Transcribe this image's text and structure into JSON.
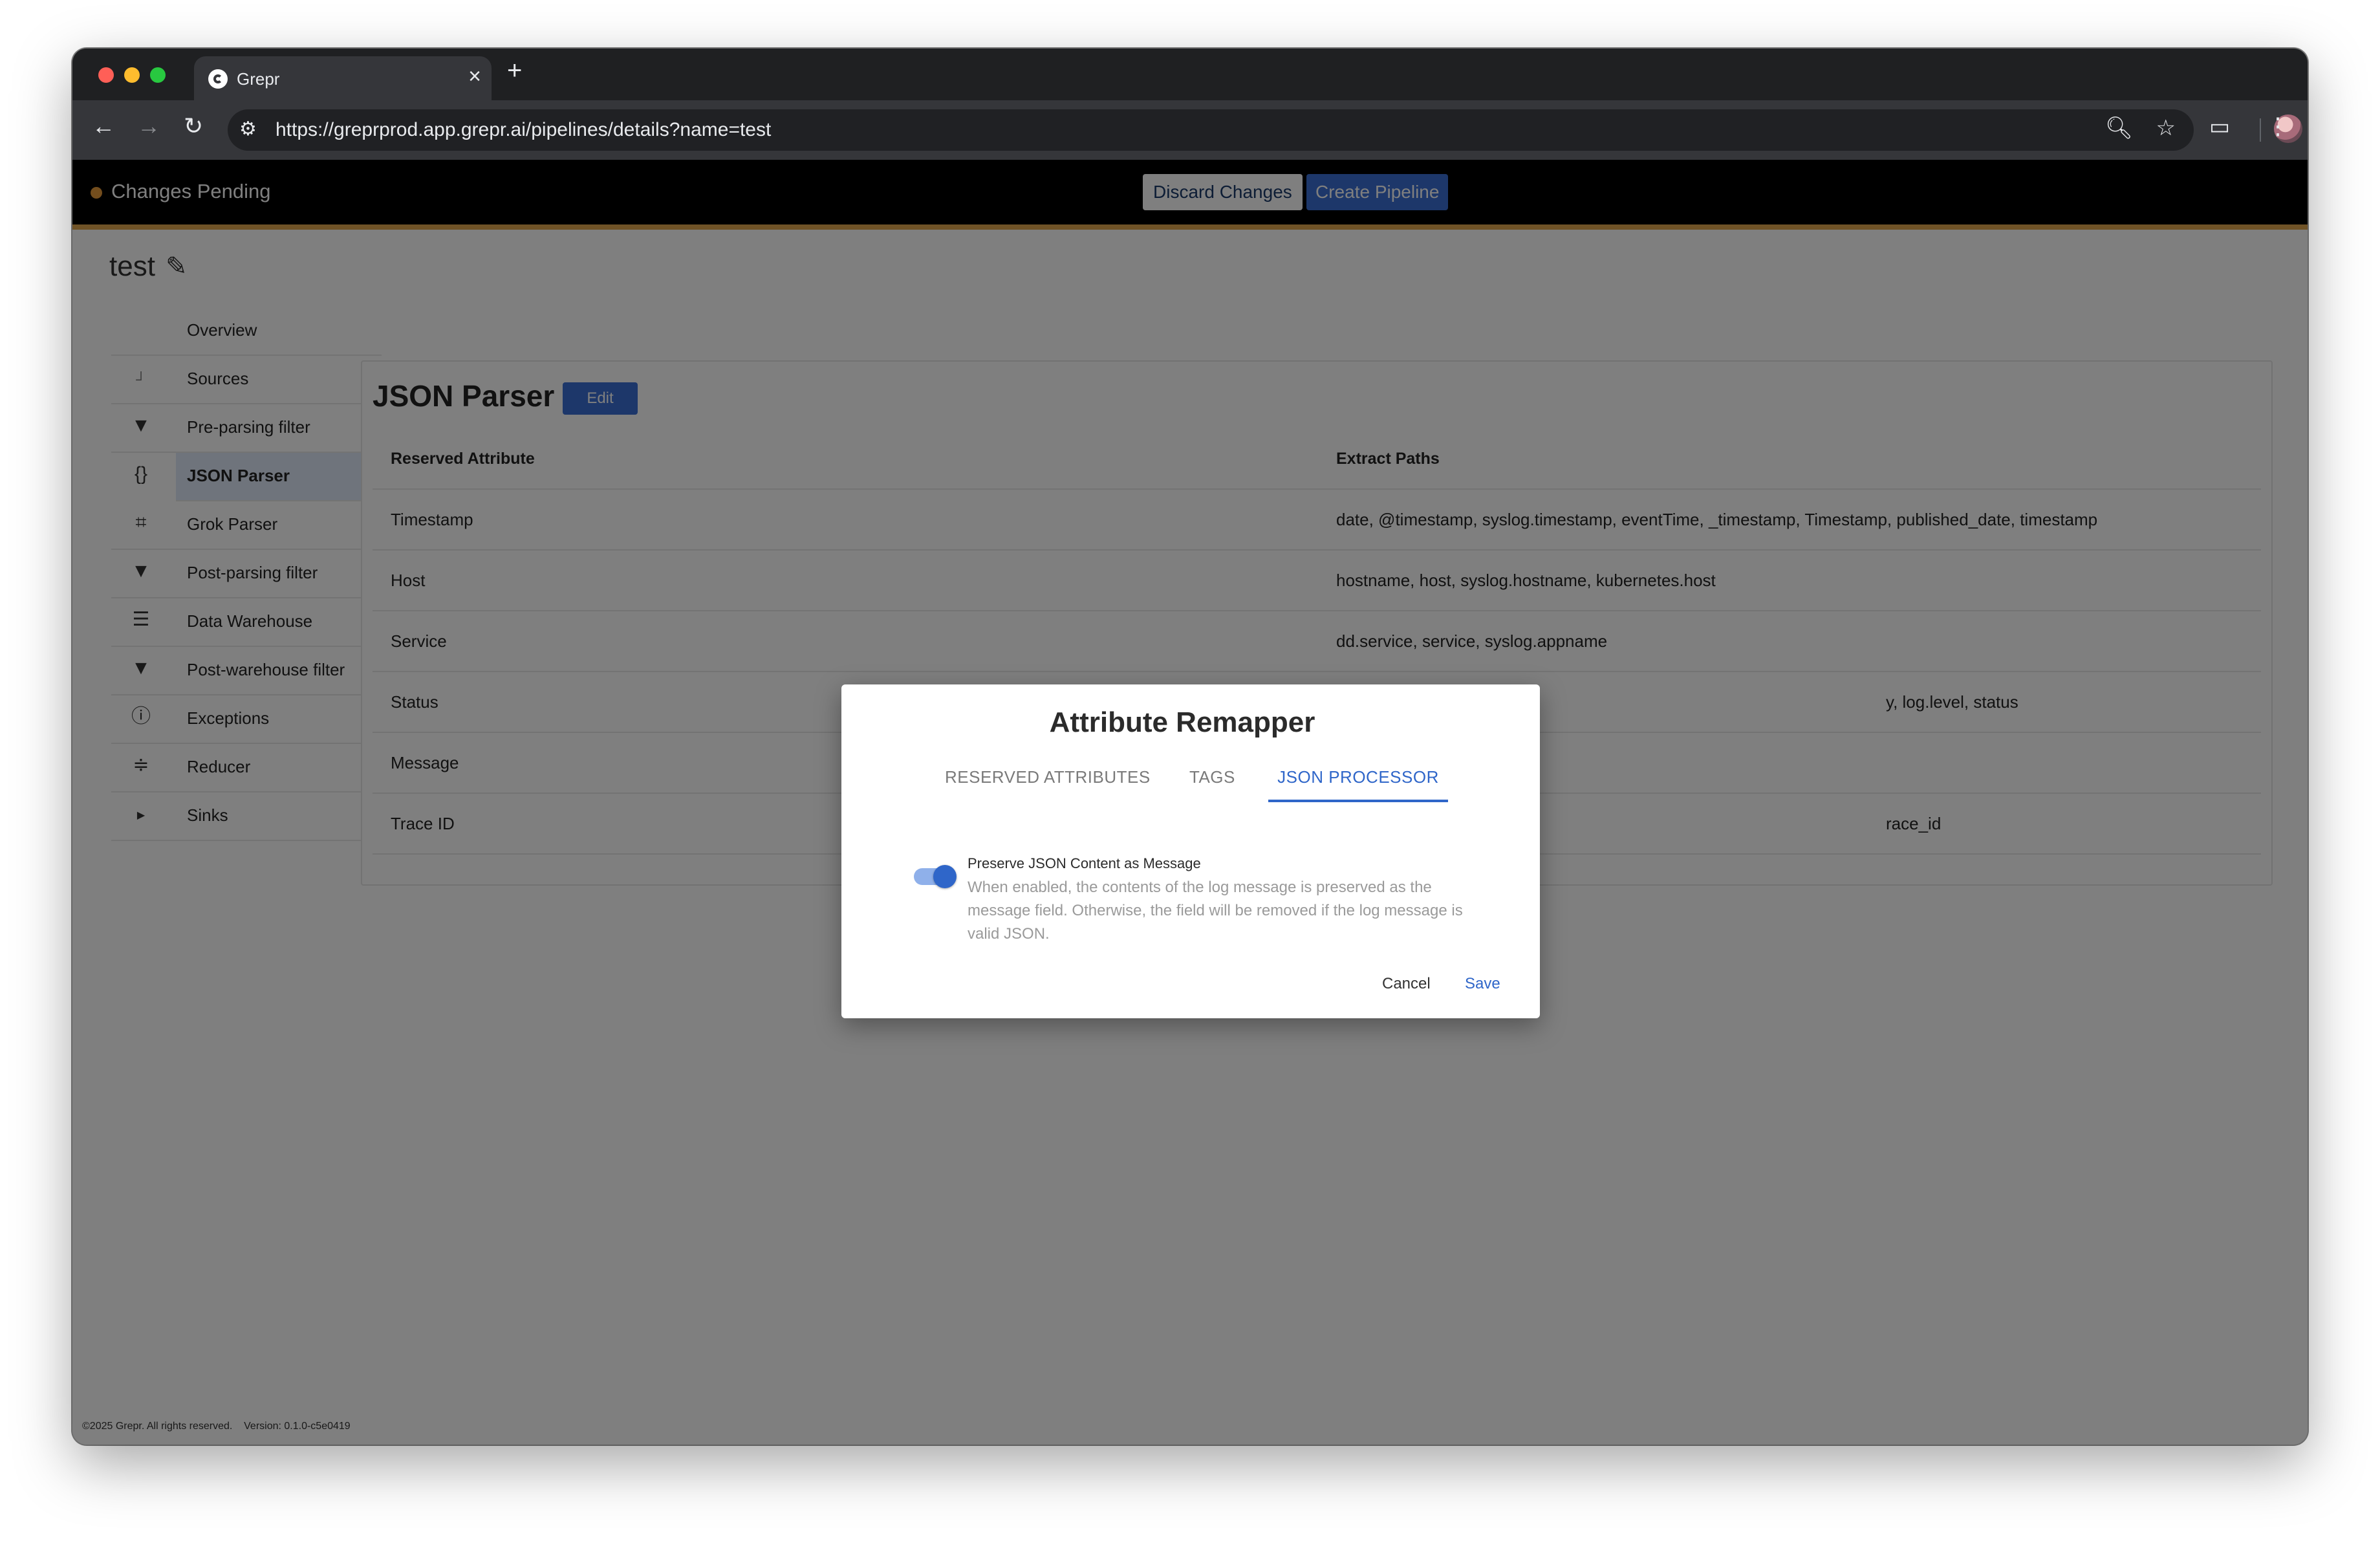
{
  "browser": {
    "tab_title": "Grepr",
    "url": "https://greprprod.app.grepr.ai/pipelines/details?name=test"
  },
  "banner": {
    "status_text": "Changes Pending",
    "discard_label": "Discard Changes",
    "create_label": "Create Pipeline"
  },
  "pipeline": {
    "name": "test"
  },
  "sidebar": {
    "items": [
      {
        "label": "Overview",
        "icon": "none"
      },
      {
        "label": "Sources",
        "icon": "branch-connector"
      },
      {
        "label": "Pre-parsing filter",
        "icon": "filter-icon"
      },
      {
        "label": "JSON Parser",
        "icon": "braces-icon"
      },
      {
        "label": "Grok Parser",
        "icon": "crop-icon"
      },
      {
        "label": "Post-parsing filter",
        "icon": "filter-icon"
      },
      {
        "label": "Data Warehouse",
        "icon": "list-icon"
      },
      {
        "label": "Post-warehouse filter",
        "icon": "filter-icon"
      },
      {
        "label": "Exceptions",
        "icon": "alert-circle-icon"
      },
      {
        "label": "Reducer",
        "icon": "compress-icon"
      },
      {
        "label": "Sinks",
        "icon": "caret-right-icon"
      }
    ]
  },
  "panel": {
    "title": "JSON Parser",
    "edit_label": "Edit",
    "columns": [
      "Reserved Attribute",
      "Extract Paths"
    ],
    "rows": [
      {
        "attribute": "Timestamp",
        "paths": "date, @timestamp, syslog.timestamp, eventTime, _timestamp, Timestamp, published_date, timestamp"
      },
      {
        "attribute": "Host",
        "paths": "hostname, host, syslog.hostname, kubernetes.host"
      },
      {
        "attribute": "Service",
        "paths": "dd.service, service, syslog.appname"
      },
      {
        "attribute": "Status",
        "paths": "y, log.level, status"
      },
      {
        "attribute": "Message",
        "paths": ""
      },
      {
        "attribute": "Trace ID",
        "paths": "race_id"
      }
    ]
  },
  "footer": {
    "copyright": "©2025 Grepr. All rights reserved.",
    "version": "Version: 0.1.0-c5e0419"
  },
  "modal": {
    "title": "Attribute Remapper",
    "tabs": [
      "RESERVED ATTRIBUTES",
      "TAGS",
      "JSON PROCESSOR"
    ],
    "active_tab": "JSON PROCESSOR",
    "toggle": {
      "label": "Preserve JSON Content as Message",
      "description": "When enabled, the contents of the log message is preserved as the message field. Otherwise, the field will be removed if the log message is valid JSON.",
      "enabled": true
    },
    "cancel_label": "Cancel",
    "save_label": "Save"
  },
  "colors": {
    "accent": "#2f66c9",
    "pending_dot": "#e69a3a",
    "banner_underline": "#e0a64e"
  }
}
